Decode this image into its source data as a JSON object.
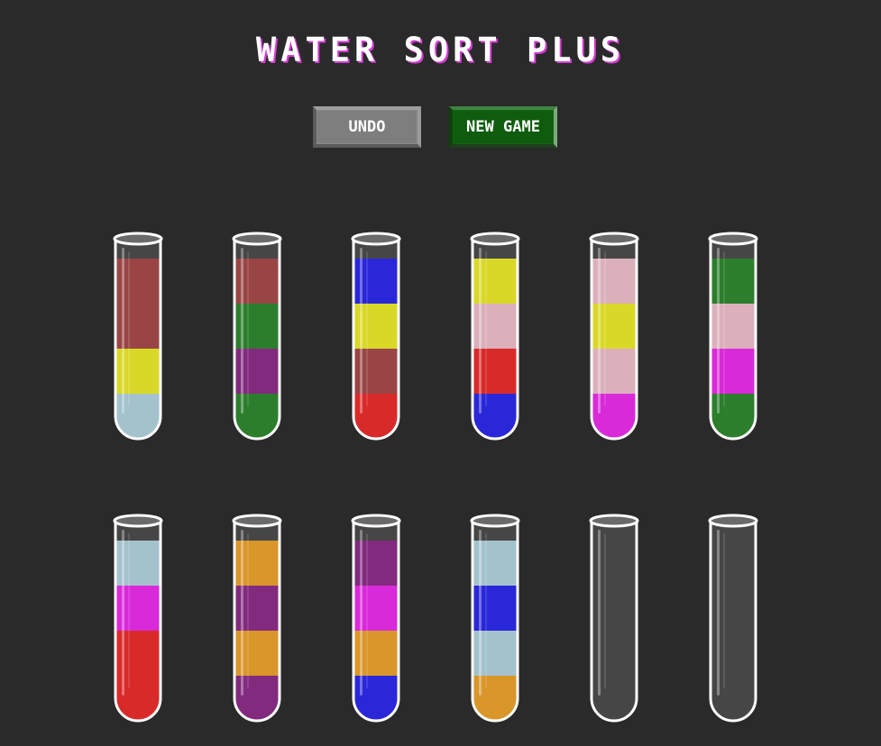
{
  "game": {
    "title": "WATER SORT PLUS",
    "undo_label": "UNDO",
    "new_game_label": "NEW GAME"
  },
  "colors": {
    "background": "#2a2a2a",
    "tube_outline": "#ffffff",
    "tube_glass": "#464646",
    "maroon": "#9a4545",
    "yellow": "#d9d829",
    "light_blue": "#a3c2cc",
    "green": "#2c7e2c",
    "purple": "#822a7e",
    "blue": "#2a27d9",
    "red": "#d92a2a",
    "pink": "#dbb0bb",
    "magenta": "#d92ad9",
    "orange": "#d9962a",
    "title_shadow": "#d63bd6"
  },
  "tubes": [
    {
      "id": 1,
      "layers_bottom_to_top": [
        "light_blue",
        "yellow",
        "maroon",
        "maroon"
      ]
    },
    {
      "id": 2,
      "layers_bottom_to_top": [
        "green",
        "purple",
        "green",
        "maroon"
      ]
    },
    {
      "id": 3,
      "layers_bottom_to_top": [
        "red",
        "maroon",
        "yellow",
        "blue"
      ]
    },
    {
      "id": 4,
      "layers_bottom_to_top": [
        "blue",
        "red",
        "pink",
        "yellow"
      ]
    },
    {
      "id": 5,
      "layers_bottom_to_top": [
        "magenta",
        "pink",
        "yellow",
        "pink"
      ]
    },
    {
      "id": 6,
      "layers_bottom_to_top": [
        "green",
        "magenta",
        "pink",
        "green"
      ]
    },
    {
      "id": 7,
      "layers_bottom_to_top": [
        "red",
        "red",
        "magenta",
        "light_blue"
      ]
    },
    {
      "id": 8,
      "layers_bottom_to_top": [
        "purple",
        "orange",
        "purple",
        "orange"
      ]
    },
    {
      "id": 9,
      "layers_bottom_to_top": [
        "blue",
        "orange",
        "magenta",
        "purple"
      ]
    },
    {
      "id": 10,
      "layers_bottom_to_top": [
        "orange",
        "light_blue",
        "blue",
        "light_blue"
      ]
    },
    {
      "id": 11,
      "layers_bottom_to_top": []
    },
    {
      "id": 12,
      "layers_bottom_to_top": []
    }
  ]
}
